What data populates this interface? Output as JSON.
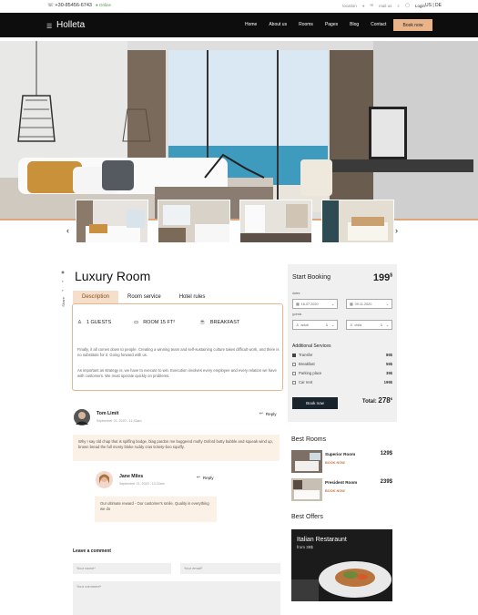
{
  "topbar": {
    "phone": "+30-85456-6743",
    "online": "Online",
    "links": [
      "location",
      "mail us"
    ],
    "login": "Login",
    "lang": "US | DE"
  },
  "nav": {
    "brand": "Holleta",
    "menu": [
      "Home",
      "About us",
      "Rooms",
      "Pages",
      "Blog",
      "Contact"
    ],
    "book": "Book now"
  },
  "room": {
    "title": "Luxury Room",
    "share": "Share",
    "tabs": [
      "Description",
      "Room service",
      "Hotel rules"
    ],
    "amenities": [
      "1 GUESTS",
      "ROOM 15 FT²",
      "BREAKFAST"
    ],
    "desc1": "Finally, it all comes down to people. Creating a winning team and self-sustaining culture takes difficult work, and there is no substitute for it. Going forward with us.",
    "desc2": "As important as strategy is, we have to execute to win. Execution involves every employee and every relation we have with customers. We must operate quickly on problems."
  },
  "comments": [
    {
      "name": "Tom Limit",
      "date": "September 21, 2020 - 11:33am",
      "text": "Why I say old chap that is spiffing bodge, blag pardon me buggered mufty Oxford butty bubble and squeak wind up, brown bread the full monty bloke ruddy cras tickety-boo squiffy.",
      "reply": "Reply"
    },
    {
      "name": "Jane Miles",
      "date": "September 21, 2020 - 10:33am",
      "text": "Our ultimate reward - Our customer's smile. Quality is everything we do",
      "reply": "Reply"
    }
  ],
  "form": {
    "heading": "Leave a comment",
    "name_ph": "Your name*",
    "email_ph": "Your email*",
    "comment_ph": "Your comment*"
  },
  "booking": {
    "title": "Start Booking",
    "price": "199",
    "currency": "$",
    "date_label": "dates",
    "guests_label": "guests",
    "date_from": "16.07.2020",
    "date_to": "09.11.2020",
    "adult": "adult",
    "adult_count": "1",
    "child": "child",
    "child_count": "1",
    "services_title": "Additional Services",
    "services": [
      {
        "label": "Transfer",
        "price": "89$",
        "checked": true
      },
      {
        "label": "Breakfast",
        "price": "59$",
        "checked": false
      },
      {
        "label": "Parking place",
        "price": "39$",
        "checked": false
      },
      {
        "label": "Car rent",
        "price": "199$",
        "checked": false
      }
    ],
    "book_label": "Book now",
    "total_label": "Total:",
    "total": "278",
    "total_currency": "$"
  },
  "best_rooms": {
    "title": "Best Rooms",
    "items": [
      {
        "name": "Superior Room",
        "price": "129$",
        "link": "BOOK NOW"
      },
      {
        "name": "President Room",
        "price": "239$",
        "link": "BOOK NOW"
      }
    ]
  },
  "best_offers": {
    "title": "Best Offers",
    "offer_name": "Italian Restaraunt",
    "offer_sub": "from 39$"
  },
  "colors": {
    "accent": "#eab48b",
    "nav_bg": "#0d0d0d",
    "tab_active": "#f5dfcb",
    "book_btn": "#18232b",
    "link": "#c8733a"
  }
}
